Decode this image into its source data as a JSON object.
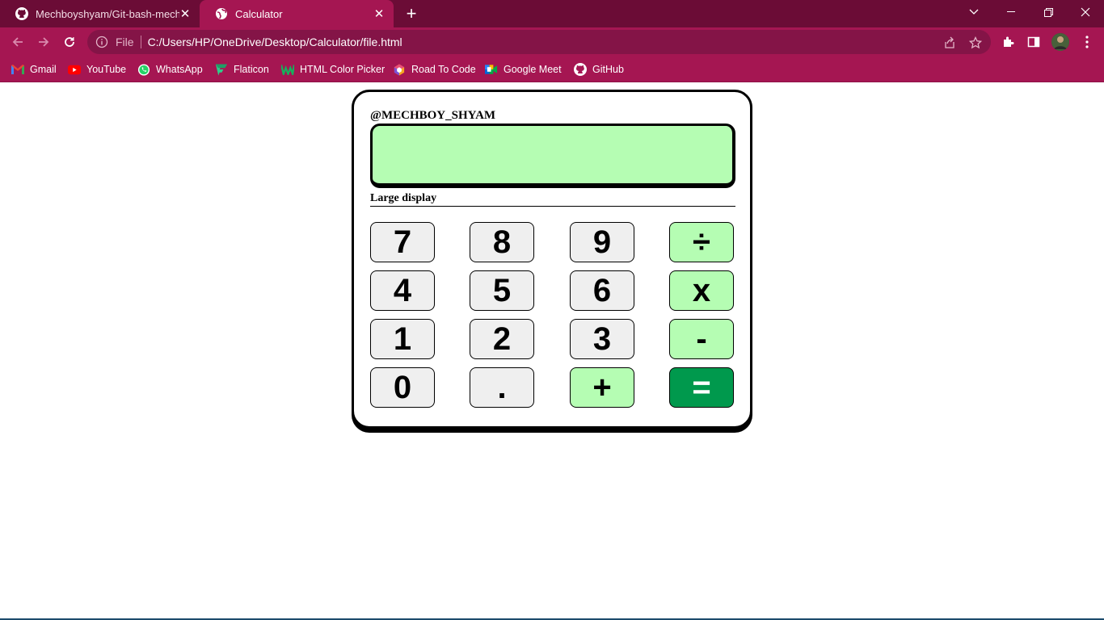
{
  "browser": {
    "tabs": [
      {
        "title": "Mechboyshyam/Git-bash-mechboyshyam",
        "icon": "github-icon",
        "active": false
      },
      {
        "title": "Calculator",
        "icon": "globe-icon",
        "active": true
      }
    ],
    "omnibox": {
      "scheme": "File",
      "url": "C:/Users/HP/OneDrive/Desktop/Calculator/file.html"
    },
    "bookmarks": [
      {
        "label": "Gmail",
        "icon": "gmail-icon"
      },
      {
        "label": "YouTube",
        "icon": "youtube-icon"
      },
      {
        "label": "WhatsApp",
        "icon": "whatsapp-icon"
      },
      {
        "label": "Flaticon",
        "icon": "flaticon-icon"
      },
      {
        "label": "HTML Color Picker",
        "icon": "color-picker-icon"
      },
      {
        "label": "Road To Code",
        "icon": "road-to-code-icon"
      },
      {
        "label": "Google Meet",
        "icon": "google-meet-icon"
      },
      {
        "label": "GitHub",
        "icon": "github-icon"
      }
    ],
    "colors": {
      "tabstrip": "#6b0c36",
      "toolbar": "#a51652"
    }
  },
  "calculator": {
    "handle": "@MECHBOY_SHYAM",
    "display_value": "",
    "display_label": "Large display",
    "keys": [
      {
        "label": "7",
        "kind": "digit"
      },
      {
        "label": "8",
        "kind": "digit"
      },
      {
        "label": "9",
        "kind": "digit"
      },
      {
        "label": "÷",
        "kind": "operator"
      },
      {
        "label": "4",
        "kind": "digit"
      },
      {
        "label": "5",
        "kind": "digit"
      },
      {
        "label": "6",
        "kind": "digit"
      },
      {
        "label": "x",
        "kind": "operator"
      },
      {
        "label": "1",
        "kind": "digit"
      },
      {
        "label": "2",
        "kind": "digit"
      },
      {
        "label": "3",
        "kind": "digit"
      },
      {
        "label": "-",
        "kind": "operator"
      },
      {
        "label": "0",
        "kind": "digit"
      },
      {
        "label": ".",
        "kind": "digit"
      },
      {
        "label": "+",
        "kind": "operator"
      },
      {
        "label": "=",
        "kind": "equals"
      }
    ],
    "colors": {
      "display": "#b5fdb3",
      "operator": "#b5fdb3",
      "equals": "#00994d",
      "digit": "#efefef"
    }
  }
}
